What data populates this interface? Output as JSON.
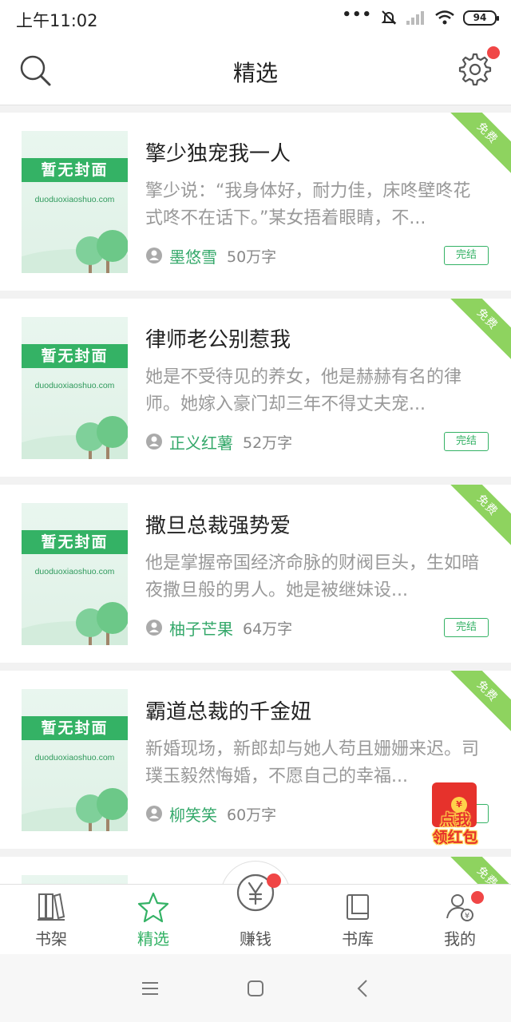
{
  "status_bar": {
    "time": "上午11:02",
    "battery": "94",
    "dots": "•••"
  },
  "header": {
    "title": "精选"
  },
  "books": [
    {
      "title": "擎少独宠我一人",
      "description": "擎少说：“我身体好，耐力佳，床咚壁咚花式咚不在话下。”某女捂着眼睛，不...",
      "author": "墨悠雪",
      "words": "50万字",
      "status": "完结",
      "badge": "免费",
      "cover_text": "暂无封面",
      "cover_url": "duoduoxiaoshuo.com"
    },
    {
      "title": "律师老公别惹我",
      "description": "她是不受待见的养女，他是赫赫有名的律师。她嫁入豪门却三年不得丈夫宠...",
      "author": "正义红薯",
      "words": "52万字",
      "status": "完结",
      "badge": "免费",
      "cover_text": "暂无封面",
      "cover_url": "duoduoxiaoshuo.com"
    },
    {
      "title": "撒旦总裁强势爱",
      "description": "他是掌握帝国经济命脉的财阀巨头，生如暗夜撒旦般的男人。她是被继妹设...",
      "author": "柚子芒果",
      "words": "64万字",
      "status": "完结",
      "badge": "免费",
      "cover_text": "暂无封面",
      "cover_url": "duoduoxiaoshuo.com"
    },
    {
      "title": "霸道总裁的千金妞",
      "description": "新婚现场，新郎却与她人苟且姗姗来迟。司璞玉毅然悔婚，不愿自己的幸福...",
      "author": "柳笑笑",
      "words": "60万字",
      "status": "完结",
      "badge": "免费",
      "cover_text": "暂无封面",
      "cover_url": "duoduoxiaoshuo.com"
    },
    {
      "title": "",
      "description": "",
      "author": "",
      "words": "",
      "status": "",
      "badge": "免费",
      "cover_text": "",
      "cover_url": ""
    }
  ],
  "red_packet": {
    "line1": "点我",
    "line2": "领红包"
  },
  "tabs": [
    {
      "label": "书架",
      "icon": "bookshelf-icon"
    },
    {
      "label": "精选",
      "icon": "star-icon",
      "active": true
    },
    {
      "label": "赚钱",
      "icon": "yen-coin-icon"
    },
    {
      "label": "书库",
      "icon": "library-icon"
    },
    {
      "label": "我的",
      "icon": "profile-icon"
    }
  ],
  "colors": {
    "accent": "#34b265",
    "badge_green": "#8ed35f",
    "notify_red": "#f04646"
  }
}
